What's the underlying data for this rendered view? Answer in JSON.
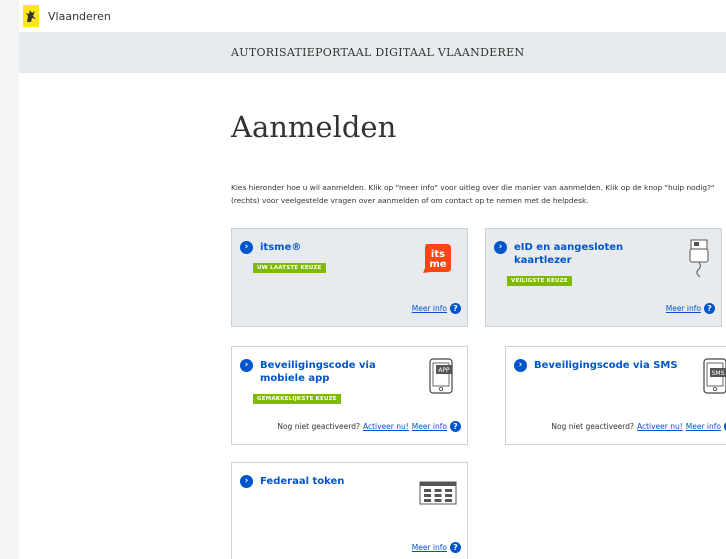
{
  "header": {
    "gov_name": "Vlaanderen"
  },
  "portal": {
    "title": "AUTORISATIEPORTAAL DIGITAAL VLAANDEREN"
  },
  "main": {
    "heading": "Aanmelden",
    "intro": "Kies hieronder hoe u wil aanmelden. Klik op \"meer info\" voor uitleg over die manier van aanmelden. Klik op de knop \"hulp nodig?\" (rechts) voor veelgestelde vragen over aanmelden of om contact op te nemen met de helpdesk."
  },
  "options": [
    {
      "title": "itsme®",
      "badge": "UW LAATSTE KEUZE",
      "more": "Meer info",
      "icon": "itsme-logo",
      "selected": true
    },
    {
      "title": "eID en aangesloten kaartlezer",
      "badge": "VEILIGSTE KEUZE",
      "more": "Meer info",
      "icon": "card-reader-icon"
    },
    {
      "title": "Beveiligingscode via mobiele app",
      "badge": "GEMAKKELIJKSTE KEUZE",
      "more": "Meer info",
      "note": "Nog niet geactiveerd?",
      "activate": "Activeer nu!",
      "icon": "phone-app-icon"
    },
    {
      "title": "Beveiligingscode via SMS",
      "more": "Meer info",
      "note": "Nog niet geactiveerd?",
      "activate": "Activeer nu!",
      "icon": "phone-sms-icon"
    },
    {
      "title": "Federaal token",
      "more": "Meer info",
      "icon": "token-card-icon"
    }
  ],
  "icons": {
    "itsme_top": "its",
    "itsme_bottom": "me",
    "app_label": "APP",
    "sms_label": "SMS",
    "help_glyph": "?",
    "chevron_glyph": "›"
  },
  "colors": {
    "brand_yellow": "#ffe615",
    "link_blue": "#0055cc",
    "badge_green": "#7fba00",
    "itsme_red": "#ff4612",
    "selected_bg": "#e8ebee"
  }
}
